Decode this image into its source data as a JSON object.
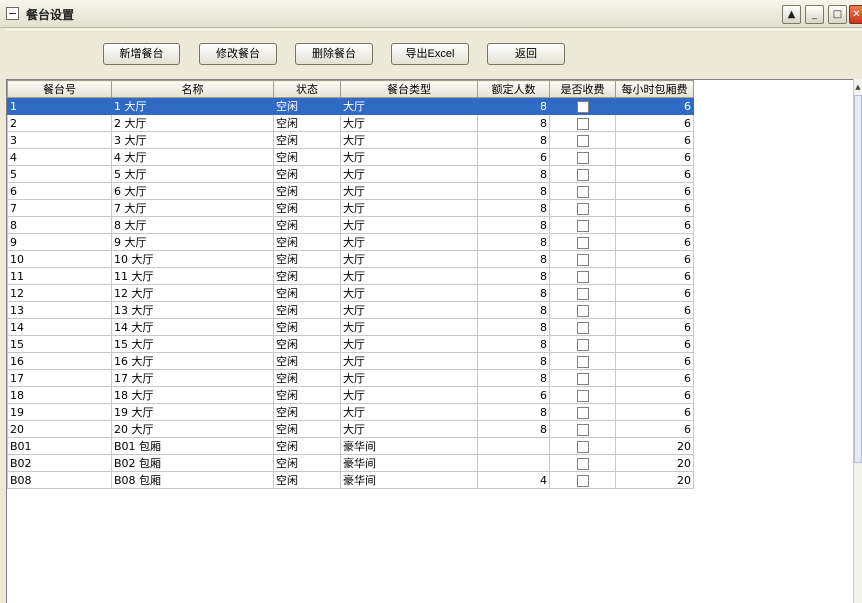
{
  "window": {
    "title": "餐台设置"
  },
  "toolbar": {
    "add_label": "新增餐台",
    "edit_label": "修改餐台",
    "delete_label": "删除餐台",
    "export_label": "导出Excel",
    "back_label": "返回"
  },
  "table": {
    "columns": [
      "餐台号",
      "名称",
      "状态",
      "餐台类型",
      "额定人数",
      "是否收费",
      "每小时包厢费"
    ],
    "selected_row": 0,
    "rows": [
      {
        "id": "1",
        "name": "1 大厅",
        "status": "空闲",
        "type": "大厅",
        "capacity": "8",
        "fee": "6"
      },
      {
        "id": "2",
        "name": "2 大厅",
        "status": "空闲",
        "type": "大厅",
        "capacity": "8",
        "fee": "6"
      },
      {
        "id": "3",
        "name": "3 大厅",
        "status": "空闲",
        "type": "大厅",
        "capacity": "8",
        "fee": "6"
      },
      {
        "id": "4",
        "name": "4 大厅",
        "status": "空闲",
        "type": "大厅",
        "capacity": "6",
        "fee": "6"
      },
      {
        "id": "5",
        "name": "5 大厅",
        "status": "空闲",
        "type": "大厅",
        "capacity": "8",
        "fee": "6"
      },
      {
        "id": "6",
        "name": "6 大厅",
        "status": "空闲",
        "type": "大厅",
        "capacity": "8",
        "fee": "6"
      },
      {
        "id": "7",
        "name": "7 大厅",
        "status": "空闲",
        "type": "大厅",
        "capacity": "8",
        "fee": "6"
      },
      {
        "id": "8",
        "name": "8 大厅",
        "status": "空闲",
        "type": "大厅",
        "capacity": "8",
        "fee": "6"
      },
      {
        "id": "9",
        "name": "9 大厅",
        "status": "空闲",
        "type": "大厅",
        "capacity": "8",
        "fee": "6"
      },
      {
        "id": "10",
        "name": "10 大厅",
        "status": "空闲",
        "type": "大厅",
        "capacity": "8",
        "fee": "6"
      },
      {
        "id": "11",
        "name": "11 大厅",
        "status": "空闲",
        "type": "大厅",
        "capacity": "8",
        "fee": "6"
      },
      {
        "id": "12",
        "name": "12 大厅",
        "status": "空闲",
        "type": "大厅",
        "capacity": "8",
        "fee": "6"
      },
      {
        "id": "13",
        "name": "13 大厅",
        "status": "空闲",
        "type": "大厅",
        "capacity": "8",
        "fee": "6"
      },
      {
        "id": "14",
        "name": "14 大厅",
        "status": "空闲",
        "type": "大厅",
        "capacity": "8",
        "fee": "6"
      },
      {
        "id": "15",
        "name": "15 大厅",
        "status": "空闲",
        "type": "大厅",
        "capacity": "8",
        "fee": "6"
      },
      {
        "id": "16",
        "name": "16 大厅",
        "status": "空闲",
        "type": "大厅",
        "capacity": "8",
        "fee": "6"
      },
      {
        "id": "17",
        "name": "17 大厅",
        "status": "空闲",
        "type": "大厅",
        "capacity": "8",
        "fee": "6"
      },
      {
        "id": "18",
        "name": "18 大厅",
        "status": "空闲",
        "type": "大厅",
        "capacity": "6",
        "fee": "6"
      },
      {
        "id": "19",
        "name": "19 大厅",
        "status": "空闲",
        "type": "大厅",
        "capacity": "8",
        "fee": "6"
      },
      {
        "id": "20",
        "name": "20 大厅",
        "status": "空闲",
        "type": "大厅",
        "capacity": "8",
        "fee": "6"
      },
      {
        "id": "B01",
        "name": "B01 包厢",
        "status": "空闲",
        "type": "豪华间",
        "capacity": "",
        "fee": "20"
      },
      {
        "id": "B02",
        "name": "B02 包厢",
        "status": "空闲",
        "type": "豪华间",
        "capacity": "",
        "fee": "20"
      },
      {
        "id": "B08",
        "name": "B08 包厢",
        "status": "空闲",
        "type": "豪华间",
        "capacity": "4",
        "fee": "20"
      }
    ]
  },
  "colors": {
    "selection": "#316ac5",
    "window_bg": "#ece9d8"
  }
}
